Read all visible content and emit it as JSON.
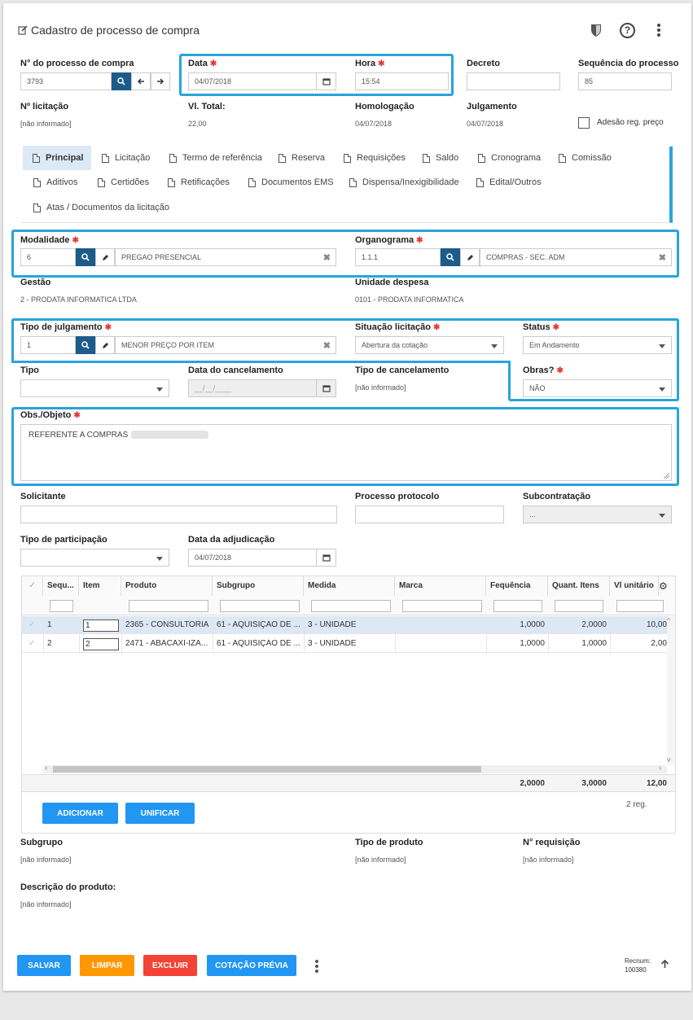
{
  "header": {
    "title": "Cadastro de processo de compra"
  },
  "processo": {
    "label": "N° do processo de compra",
    "value": "3793"
  },
  "data": {
    "label": "Data",
    "value": "04/07/2018"
  },
  "hora": {
    "label": "Hora",
    "value": "15:54"
  },
  "decreto": {
    "label": "Decreto",
    "value": ""
  },
  "sequencia": {
    "label": "Sequência do processo",
    "value": "85"
  },
  "licitacao": {
    "label": "Nº licitação",
    "value": "[não informado]"
  },
  "vltotal": {
    "label": "Vl. Total:",
    "value": "22,00"
  },
  "homologacao": {
    "label": "Homologação",
    "value": "04/07/2018"
  },
  "julgamento": {
    "label": "Julgamento",
    "value": "04/07/2018"
  },
  "adesao": {
    "label": "Adesão reg. preço"
  },
  "tabs": [
    "Principal",
    "Licitação",
    "Termo de referência",
    "Reserva",
    "Requisições",
    "Saldo",
    "Cronograma",
    "Comissão",
    "Aditivos",
    "Certidões",
    "Retificações",
    "Documentos EMS",
    "Dispensa/Inexigibilidade",
    "Edital/Outros",
    "Atas / Documentos da licitação"
  ],
  "modalidade": {
    "label": "Modalidade",
    "code": "6",
    "desc": "PREGAO PRESENCIAL"
  },
  "organograma": {
    "label": "Organograma",
    "code": "1.1.1",
    "desc": "COMPRAS - SEC. ADM"
  },
  "gestao": {
    "label": "Gestão",
    "value": "2 - PRODATA INFORMATICA LTDA"
  },
  "unidade": {
    "label": "Unidade despesa",
    "value": "0101 - PRODATA INFORMATICA"
  },
  "tipo_julgamento": {
    "label": "Tipo de julgamento",
    "code": "1",
    "desc": "MENOR PREÇO POR ITEM"
  },
  "situacao": {
    "label": "Situação licitação",
    "value": "Abertura da cotação"
  },
  "status": {
    "label": "Status",
    "value": "Em Andamento"
  },
  "tipo": {
    "label": "Tipo",
    "value": ""
  },
  "data_cancel": {
    "label": "Data do cancelamento",
    "placeholder": "__/__/____"
  },
  "tipo_cancel": {
    "label": "Tipo de cancelamento",
    "value": "[não informado]"
  },
  "obras": {
    "label": "Obras?",
    "value": "NÃO"
  },
  "obs": {
    "label": "Obs./Objeto",
    "value": "REFERENTE A COMPRAS"
  },
  "solicitante": {
    "label": "Solicitante",
    "value": ""
  },
  "protocolo": {
    "label": "Processo protocolo",
    "value": ""
  },
  "subcontratacao": {
    "label": "Subcontratação",
    "value": "..."
  },
  "tipo_part": {
    "label": "Tipo de participação",
    "value": ""
  },
  "data_adj": {
    "label": "Data da adjudicação",
    "value": "04/07/2018"
  },
  "grid": {
    "columns": [
      "Sequ...",
      "Item",
      "Produto",
      "Subgrupo",
      "Medida",
      "Marca",
      "Fequência",
      "Quant. Itens",
      "Vl unitário"
    ],
    "rows": [
      {
        "seq": "1",
        "item": "1",
        "produto": "2365 - CONSULTORIA",
        "subgrupo": "61 - AQUISIÇÃO DE ...",
        "medida": "3 - UNIDADE",
        "marca": "",
        "freq": "1,0000",
        "quant": "2,0000",
        "vl": "10,00"
      },
      {
        "seq": "2",
        "item": "2",
        "produto": "2471 - ABACAXI-IZA...",
        "subgrupo": "61 - AQUISIÇÃO DE ...",
        "medida": "3 - UNIDADE",
        "marca": "",
        "freq": "1,0000",
        "quant": "1,0000",
        "vl": "2,00"
      }
    ],
    "totals": {
      "freq": "2,0000",
      "quant": "3,0000",
      "vl": "12,00"
    },
    "count": "2 reg."
  },
  "grid_buttons": {
    "adicionar": "ADICIONAR",
    "unificar": "UNIFICAR"
  },
  "subgrupo": {
    "label": "Subgrupo",
    "value": "[não informado]"
  },
  "tipo_produto": {
    "label": "Tipo de produto",
    "value": "[não informado]"
  },
  "requisicao": {
    "label": "N° requisição",
    "value": "[não informado]"
  },
  "descricao": {
    "label": "Descrição do produto:",
    "value": "[não informado]"
  },
  "footer": {
    "salvar": "SALVAR",
    "limpar": "LIMPAR",
    "excluir": "EXCLUIR",
    "cotacao": "COTAÇÃO PRÉVIA",
    "recnum_label": "Recnum:",
    "recnum": "100380"
  },
  "colors": {
    "blue": "#1c5c8a",
    "highlight": "#29a3dd",
    "save": "#2196f3",
    "clear": "#ff9800",
    "delete": "#f44336"
  }
}
